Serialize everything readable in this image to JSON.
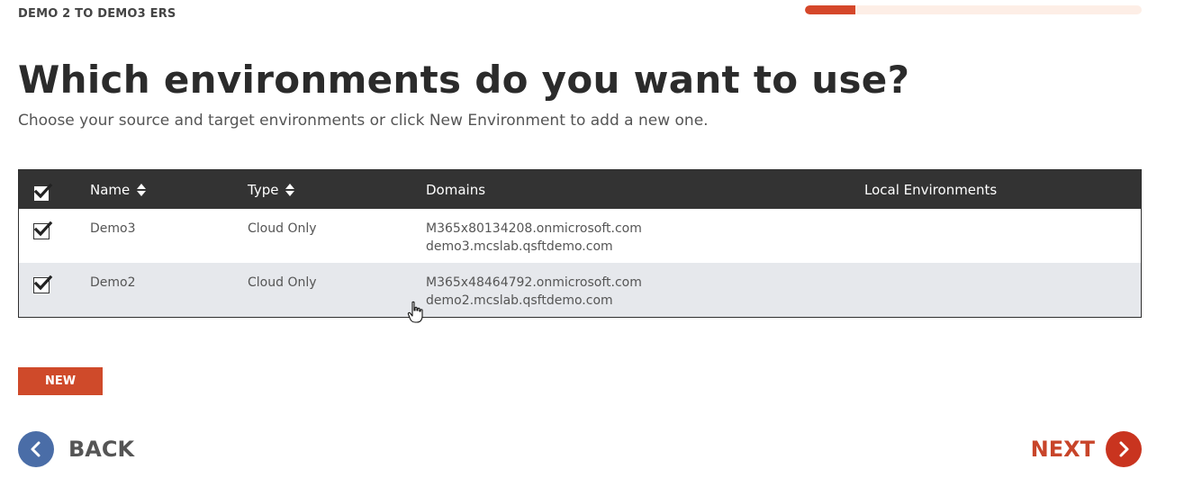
{
  "header": {
    "project_name": "DEMO 2 TO DEMO3 ERS",
    "progress_fraction": 0.15
  },
  "title": "Which environments do you want to use?",
  "subtitle": "Choose your source and target environments or click New Environment to add a new one.",
  "table": {
    "columns": [
      "Name",
      "Type",
      "Domains",
      "Local Environments"
    ],
    "select_all_checked": true,
    "rows": [
      {
        "checked": true,
        "name": "Demo3",
        "type": "Cloud Only",
        "domains": [
          "M365x80134208.onmicrosoft.com",
          "demo3.mcslab.qsftdemo.com"
        ],
        "local_environments": ""
      },
      {
        "checked": true,
        "name": "Demo2",
        "type": "Cloud Only",
        "domains": [
          "M365x48464792.onmicrosoft.com",
          "demo2.mcslab.qsftdemo.com"
        ],
        "local_environments": ""
      }
    ]
  },
  "buttons": {
    "new_label": "NEW",
    "back_label": "BACK",
    "next_label": "NEXT"
  },
  "icons": {
    "sort": "sort-icon",
    "check": "check-icon",
    "back": "chevron-left-icon",
    "next": "chevron-right-icon",
    "cursor": "hand-cursor-icon"
  },
  "colors": {
    "accent": "#cf4a2a",
    "header_bg": "#333333",
    "back_circle": "#4a6da7",
    "row_alt": "#e6e8ec"
  }
}
